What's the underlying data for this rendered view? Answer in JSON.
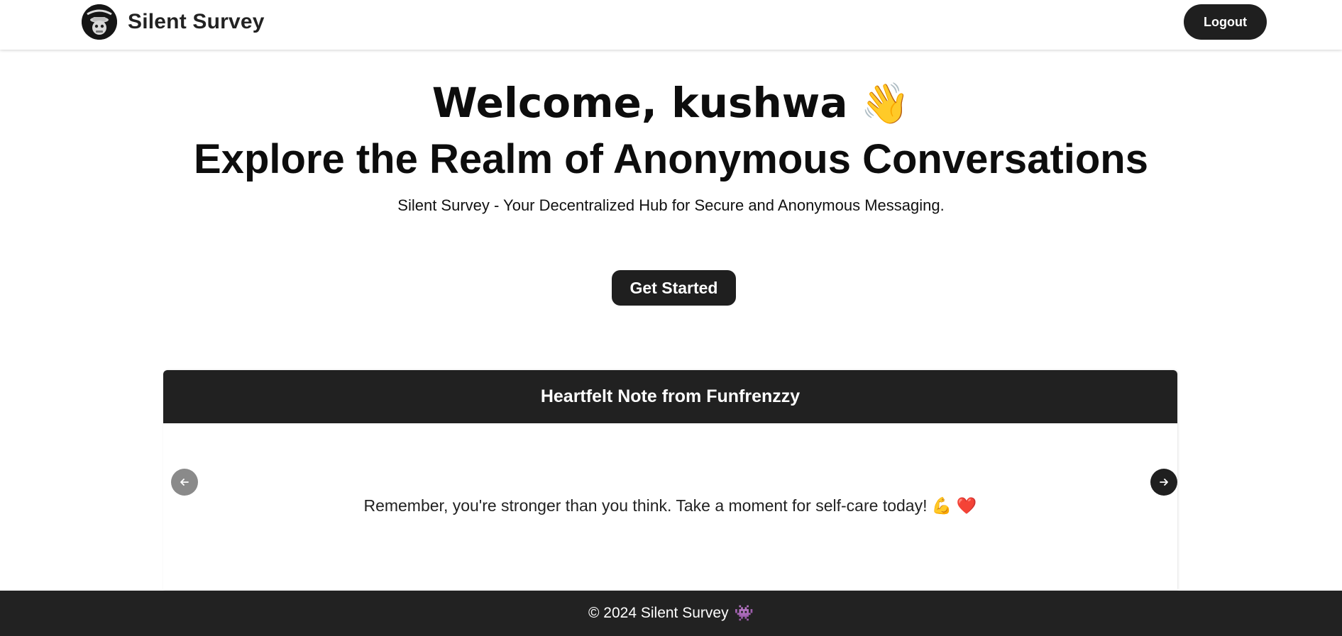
{
  "navbar": {
    "brand_title": "Silent Survey",
    "logout_label": "Logout",
    "logo_icon": "silent-survey-logo-icon"
  },
  "hero": {
    "welcome_text": "Welcome, kushwa",
    "welcome_emoji": "👋",
    "title": "Explore the Realm of Anonymous Conversations",
    "subtitle": "Silent Survey - Your Decentralized Hub for Secure and Anonymous Messaging.",
    "cta_label": "Get Started"
  },
  "carousel": {
    "card_title": "Heartfelt Note from Funfrenzzy",
    "message": "Remember, you're stronger than you think. Take a moment for self-care today! 💪 ❤️",
    "prev_icon": "arrow-left-icon",
    "next_icon": "arrow-right-icon"
  },
  "footer": {
    "copyright": "© 2024 Silent Survey",
    "icon": "alien-monster-icon",
    "icon_glyph": "👾"
  },
  "colors": {
    "dark": "#1f1f1f",
    "card_header": "#212121",
    "footer_bg": "#222222",
    "prev_arrow_bg": "#8a8a8a"
  }
}
